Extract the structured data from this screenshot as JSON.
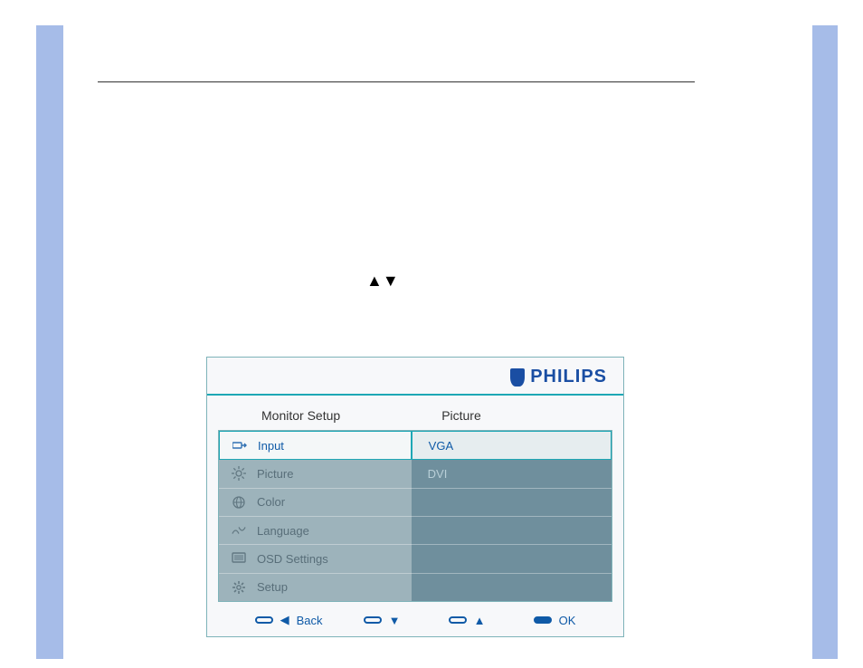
{
  "brand": "PHILIPS",
  "headers": {
    "left": "Monitor Setup",
    "right": "Picture"
  },
  "menu": {
    "left": [
      {
        "label": "Input",
        "selected": true,
        "icon": "input-icon"
      },
      {
        "label": "Picture",
        "selected": false,
        "icon": "brightness-icon"
      },
      {
        "label": "Color",
        "selected": false,
        "icon": "globe-icon"
      },
      {
        "label": "Language",
        "selected": false,
        "icon": "language-icon"
      },
      {
        "label": "OSD Settings",
        "selected": false,
        "icon": "screen-icon"
      },
      {
        "label": "Setup",
        "selected": false,
        "icon": "gear-icon"
      }
    ],
    "right": [
      {
        "label": "VGA",
        "selected": true
      },
      {
        "label": "DVI",
        "selected": false
      },
      {
        "label": "",
        "selected": false
      },
      {
        "label": "",
        "selected": false
      },
      {
        "label": "",
        "selected": false
      },
      {
        "label": "",
        "selected": false
      }
    ]
  },
  "footer": {
    "back": "Back",
    "down": "",
    "up": "",
    "ok": "OK"
  },
  "inline_arrows": "▲▼"
}
